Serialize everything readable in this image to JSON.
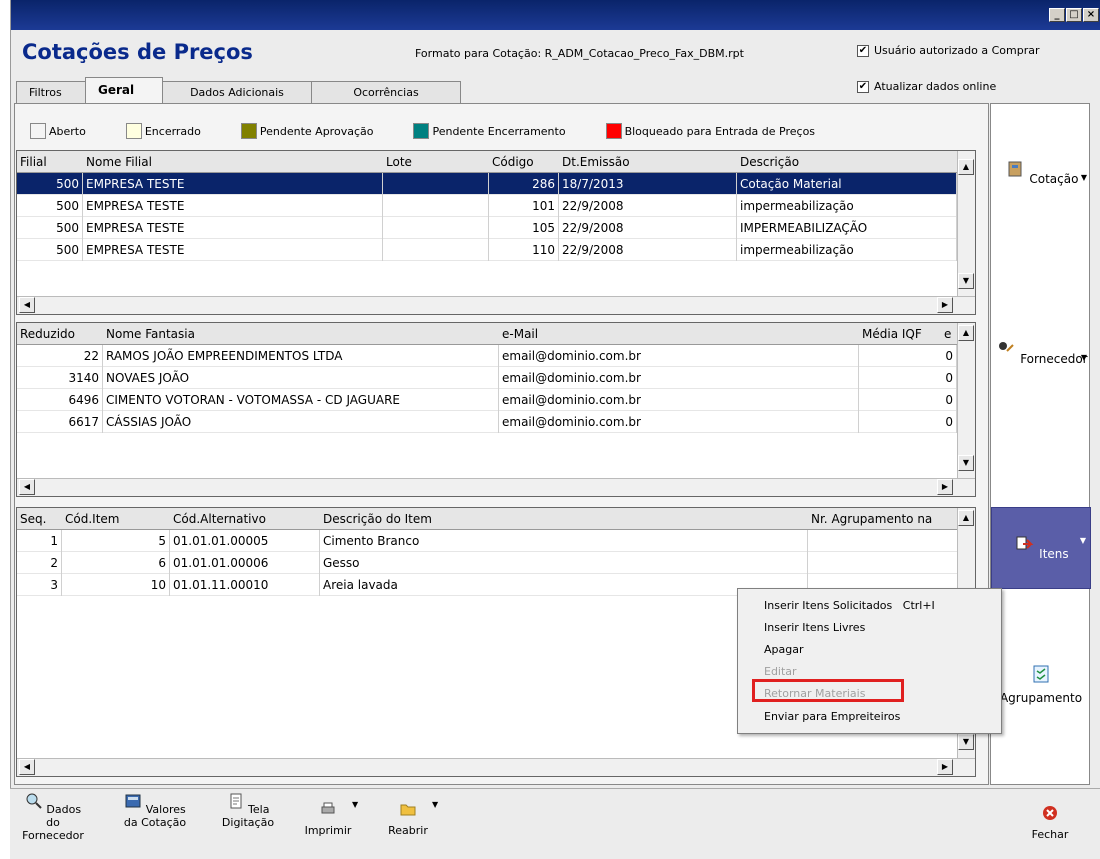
{
  "app": {
    "title": "Cotações de Preços"
  },
  "header": {
    "format_label": "Formato para Cotação: R_ADM_Cotacao_Preco_Fax_DBM.rpt",
    "chk_authorized": "Usuário autorizado a Comprar",
    "chk_online": "Atualizar dados online"
  },
  "tabs": [
    "Filtros",
    "Geral",
    "Dados Adicionais",
    "Ocorrências"
  ],
  "legend": [
    {
      "label": "Aberto",
      "color": "#f4f4f4"
    },
    {
      "label": "Encerrado",
      "color": "#ffffe0"
    },
    {
      "label": "Pendente Aprovação",
      "color": "#808000"
    },
    {
      "label": "Pendente Encerramento",
      "color": "#008080"
    },
    {
      "label": "Bloqueado para Entrada de Preços",
      "color": "#ff0000"
    }
  ],
  "grid1": {
    "headers": [
      "Filial",
      "Nome Filial",
      "Lote",
      "Código",
      "Dt.Emissão",
      "Descrição"
    ],
    "rows": [
      [
        "500",
        "EMPRESA TESTE",
        "",
        "286",
        "18/7/2013",
        "Cotação Material"
      ],
      [
        "500",
        "EMPRESA TESTE",
        "",
        "101",
        "22/9/2008",
        "impermeabilização"
      ],
      [
        "500",
        "EMPRESA TESTE",
        "",
        "105",
        "22/9/2008",
        "IMPERMEABILIZAÇÃO"
      ],
      [
        "500",
        "EMPRESA TESTE",
        "",
        "110",
        "22/9/2008",
        "impermeabilização"
      ]
    ]
  },
  "grid2": {
    "headers": [
      "Reduzido",
      "Nome Fantasia",
      "e-Mail",
      "Média IQF",
      "e"
    ],
    "rows": [
      [
        "22",
        "RAMOS JOÃO EMPREENDIMENTOS LTDA",
        "email@dominio.com.br",
        "0"
      ],
      [
        "3140",
        "NOVAES JOÃO",
        "email@dominio.com.br",
        "0"
      ],
      [
        "6496",
        "CIMENTO VOTORAN - VOTOMASSA - CD JAGUARE",
        "email@dominio.com.br",
        "0"
      ],
      [
        "6617",
        "CÁSSIAS JOÃO",
        "email@dominio.com.br",
        "0"
      ]
    ]
  },
  "grid3": {
    "headers": [
      "Seq.",
      "Cód.Item",
      "Cód.Alternativo",
      "Descrição do Item",
      "Nr. Agrupamento na"
    ],
    "rows": [
      [
        "1",
        "5",
        "01.01.01.00005",
        "Cimento Branco",
        ""
      ],
      [
        "2",
        "6",
        "01.01.01.00006",
        "Gesso",
        ""
      ],
      [
        "3",
        "10",
        "01.01.11.00010",
        "Areia lavada",
        ""
      ]
    ]
  },
  "right_panel": [
    "Cotação",
    "Fornecedor",
    "Itens",
    "Agrupamento"
  ],
  "context_menu": {
    "items": [
      {
        "label": "Inserir Itens Solicitados",
        "shortcut": "Ctrl+I",
        "enabled": true
      },
      {
        "label": "Inserir Itens Livres",
        "enabled": true
      },
      {
        "label": "Apagar",
        "enabled": true
      },
      {
        "label": "Editar",
        "enabled": false
      },
      {
        "label": "Retornar Materiais",
        "enabled": false
      },
      {
        "label": "Enviar para Empreiteiros",
        "enabled": true
      }
    ]
  },
  "toolbar": {
    "dados_fornecedor": "Dados do Fornecedor",
    "valores_cotacao": "Valores da Cotação",
    "tela_digitacao": "Tela Digitação",
    "imprimir": "Imprimir",
    "reabrir": "Reabrir",
    "fechar": "Fechar"
  },
  "colors": {
    "selected_row": "#0a246a",
    "accent": "#0a2a8c",
    "active_button": "#5a5ea8",
    "highlight": "#e02020"
  }
}
